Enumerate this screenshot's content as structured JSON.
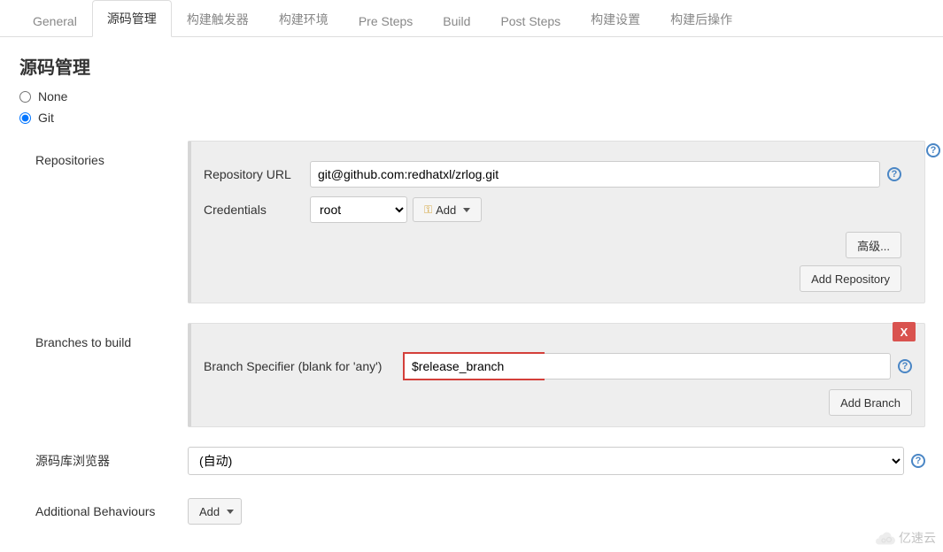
{
  "tabs": {
    "general": "General",
    "scm": "源码管理",
    "triggers": "构建触发器",
    "env": "构建环境",
    "pre": "Pre Steps",
    "build": "Build",
    "post": "Post Steps",
    "settings": "构建设置",
    "postbuild": "构建后操作"
  },
  "section_title": "源码管理",
  "radio": {
    "none": "None",
    "git": "Git"
  },
  "repos": {
    "section_label": "Repositories",
    "url_label": "Repository URL",
    "url_value": "git@github.com:redhatxl/zrlog.git",
    "cred_label": "Credentials",
    "cred_selected": "root",
    "add_cred_btn": "Add",
    "advanced_btn": "高级...",
    "add_repo_btn": "Add Repository"
  },
  "branches": {
    "section_label": "Branches to build",
    "spec_label": "Branch Specifier (blank for 'any')",
    "spec_value": "$release_branch",
    "delete_label": "X",
    "add_branch_btn": "Add Branch"
  },
  "browser": {
    "label": "源码库浏览器",
    "selected": "(自动)"
  },
  "behaviours": {
    "label": "Additional Behaviours",
    "add_btn": "Add"
  },
  "help_glyph": "?",
  "watermark": "亿速云"
}
